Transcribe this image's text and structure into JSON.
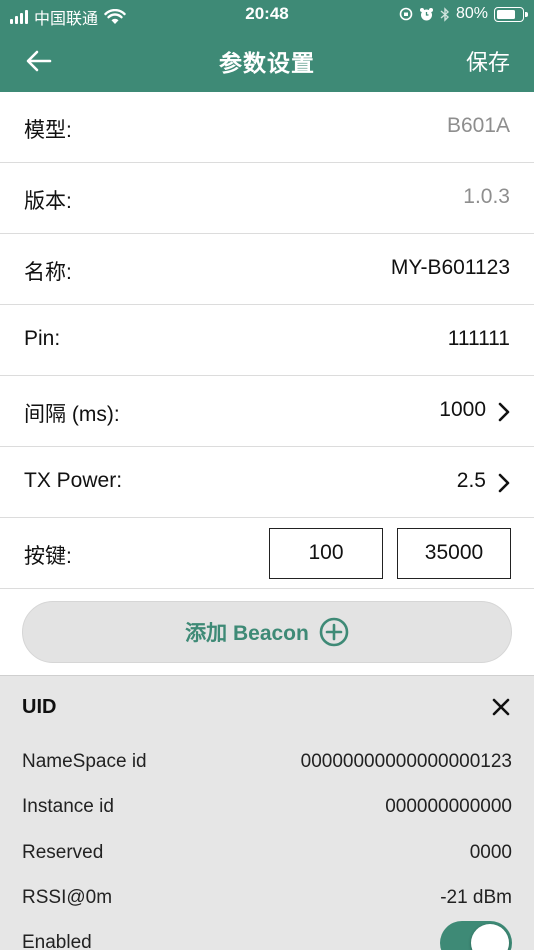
{
  "status_bar": {
    "carrier": "中国联通",
    "time": "20:48",
    "battery": "80%",
    "battery_level": 0.8
  },
  "navbar": {
    "title": "参数设置",
    "save_label": "保存"
  },
  "params": [
    {
      "label": "模型:",
      "value": "B601A"
    },
    {
      "label": "版本:",
      "value": "1.0.3"
    },
    {
      "label": "名称:",
      "value": "MY-B601123"
    },
    {
      "label": "Pin:",
      "value": "111111"
    },
    {
      "label": "间隔 (ms):",
      "value": "1000"
    },
    {
      "label": "TX Power:",
      "value": "2.5"
    }
  ],
  "keys": {
    "label": "按键:",
    "value1": "100",
    "value2": "35000"
  },
  "add_beacon": {
    "label": "添加 Beacon"
  },
  "uid_panel": {
    "title": "UID",
    "rows": [
      {
        "label": "NameSpace id",
        "value": "00000000000000000123"
      },
      {
        "label": "Instance id",
        "value": "000000000000"
      },
      {
        "label": "Reserved",
        "value": "0000"
      },
      {
        "label": "RSSI@0m",
        "value": "-21 dBm"
      }
    ],
    "enabled_label": "Enabled",
    "enabled": true
  },
  "colors": {
    "accent": "#3e8a76",
    "muted_text": "#8e8e8e",
    "panel_bg": "#e6e6e6"
  }
}
